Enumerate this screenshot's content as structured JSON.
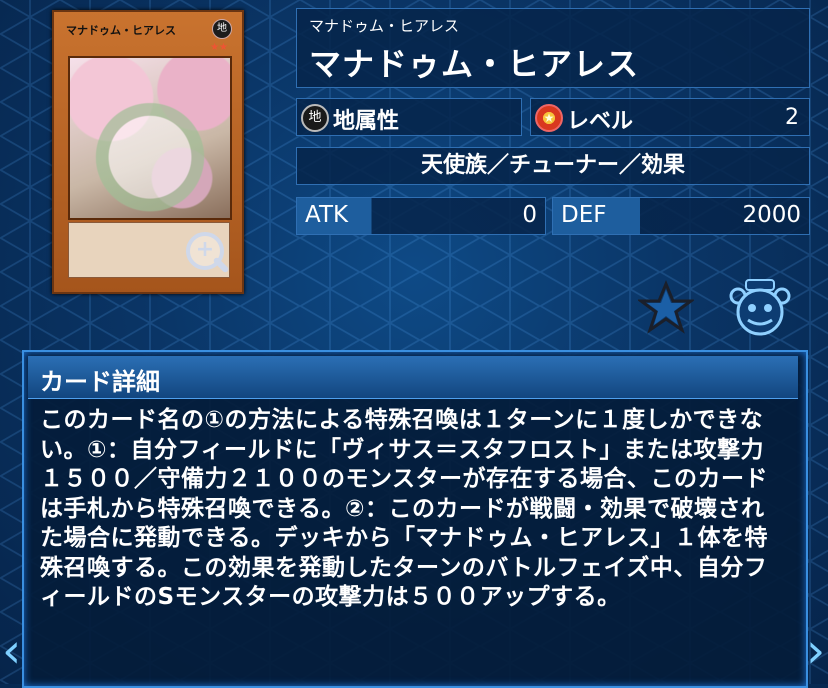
{
  "card": {
    "image_name": "マナドゥム・ヒアレス",
    "image_attr": "地",
    "image_stars": "★★"
  },
  "info": {
    "ruby": "マナドゥム・ヒアレス",
    "name": "マナドゥム・ヒアレス",
    "attribute_label": "地属性",
    "attribute_icon": "地",
    "level_label": "レベル",
    "level_value": "2",
    "type_line": "天使族／チューナー／効果",
    "atk_label": "ATK",
    "atk_value": "0",
    "def_label": "DEF",
    "def_value": "2000"
  },
  "actions": {
    "favorite_icon": "star-icon",
    "pot_icon": "jar-icon"
  },
  "detail": {
    "heading": "カード詳細",
    "text": "このカード名の①の方法による特殊召喚は１ターンに１度しかできない。①：自分フィールドに「ヴィサス＝スタフロスト」または攻撃力１５００／守備力２１００のモンスターが存在する場合、このカードは手札から特殊召喚できる。②：このカードが戦闘・効果で破壊された場合に発動できる。デッキから「マナドゥム・ヒアレス」１体を特殊召喚する。この効果を発動したターンのバトルフェイズ中、自分フィールドのSモンスターの攻撃力は５００アップする。"
  },
  "nav": {
    "prev": "‹",
    "next": "›"
  },
  "colors": {
    "accent": "#3a8fe0",
    "background": "#0a3566"
  }
}
